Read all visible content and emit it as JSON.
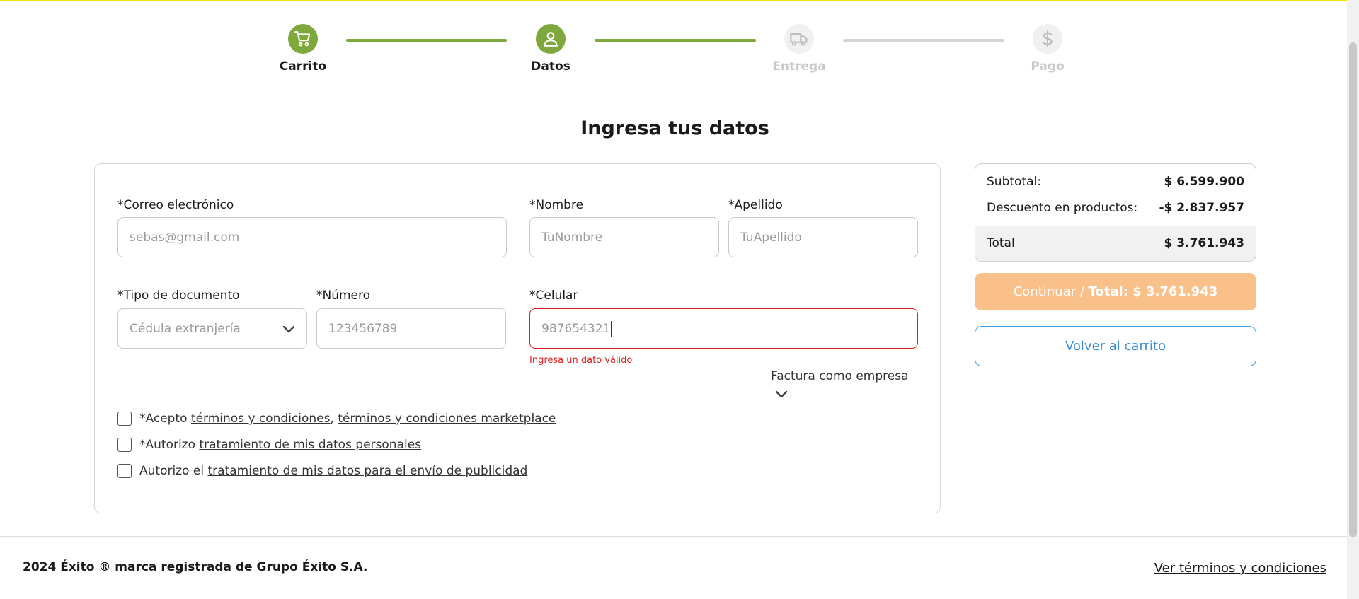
{
  "stepper": {
    "steps": [
      {
        "label": "Carrito",
        "state": "active",
        "icon": "cart-icon"
      },
      {
        "label": "Datos",
        "state": "active",
        "icon": "user-icon"
      },
      {
        "label": "Entrega",
        "state": "inactive",
        "icon": "truck-icon"
      },
      {
        "label": "Pago",
        "state": "inactive",
        "icon": "dollar-icon"
      }
    ],
    "colors": {
      "active": "#7fa83c",
      "inactive": "#d4d4d4"
    }
  },
  "page": {
    "title": "Ingresa tus datos"
  },
  "form": {
    "email": {
      "label": "*Correo electrónico",
      "placeholder": "sebas@gmail.com"
    },
    "nombre": {
      "label": "*Nombre",
      "placeholder": "TuNombre"
    },
    "apellido": {
      "label": "*Apellido",
      "placeholder": "TuApellido"
    },
    "tipo_documento": {
      "label": "*Tipo de documento",
      "selected": "Cédula extranjería"
    },
    "numero": {
      "label": "*Número",
      "placeholder": "123456789"
    },
    "celular": {
      "label": "*Celular",
      "value": "987654321",
      "error": "Ingresa un dato válido"
    },
    "factura_empresa": "Factura como empresa",
    "checks": {
      "terminos": {
        "prefix": "*Acepto ",
        "link1": "términos y condiciones",
        "sep": ", ",
        "link2": "términos y condiciones marketplace"
      },
      "datos": {
        "prefix": "*Autorizo ",
        "link": "tratamiento de mis datos personales"
      },
      "publicidad": {
        "prefix": "Autorizo el ",
        "link": "tratamiento de mis datos para el envío de publicidad"
      }
    }
  },
  "summary": {
    "subtotal_label": "Subtotal:",
    "subtotal_value": "$ 6.599.900",
    "descuento_label": "Descuento en productos:",
    "descuento_value": "-$ 2.837.957",
    "total_label": "Total",
    "total_value": "$ 3.761.943"
  },
  "buttons": {
    "continuar_prefix": "Continuar / ",
    "continuar_total": "Total: $ 3.761.943",
    "volver": "Volver al carrito"
  },
  "footer": {
    "copyright": "2024 Éxito ® marca registrada de Grupo Éxito S.A.",
    "terms_link": "Ver términos y condiciones"
  },
  "colors": {
    "brand_green": "#7fa83c",
    "error_red": "#e02020",
    "continue_orange": "#f9c08a",
    "link_blue": "#3d9ee0",
    "top_yellow": "#f5e400"
  }
}
